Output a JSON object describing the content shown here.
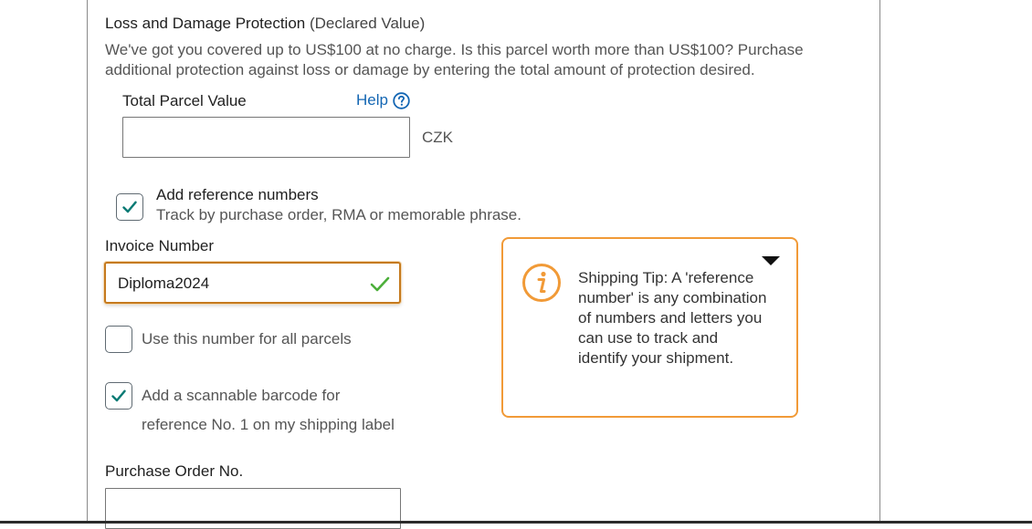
{
  "protection": {
    "title": "Loss and Damage Protection",
    "title_suffix": "(Declared Value)",
    "description": "We've got you covered up to US$100 at no charge. Is this parcel worth more than US$100? Purchase additional protection against loss or damage by entering the total amount of protection desired.",
    "parcel_value_label": "Total Parcel Value",
    "help_label": "Help",
    "parcel_value": "",
    "currency": "CZK"
  },
  "reference": {
    "checked": true,
    "title": "Add reference numbers",
    "subtitle": "Track by purchase order, RMA or memorable phrase."
  },
  "invoice": {
    "label": "Invoice Number",
    "value": "Diploma2024",
    "use_for_all_label": "Use this number for all parcels",
    "use_for_all_checked": false,
    "barcode_label_line1": "Add a scannable barcode for",
    "barcode_label_line2": "reference No. 1 on my shipping label",
    "barcode_checked": true
  },
  "purchase_order": {
    "label": "Purchase Order No.",
    "value": ""
  },
  "tip": {
    "heading": "Shipping Tip:",
    "body": "A 'reference number' is any combination of numbers and letters you can use to track and identify your shipment."
  },
  "colors": {
    "accent_orange": "#f19a37",
    "link_blue": "#1366b3",
    "check_teal": "#0a7a74",
    "valid_green": "#4caf3a"
  }
}
